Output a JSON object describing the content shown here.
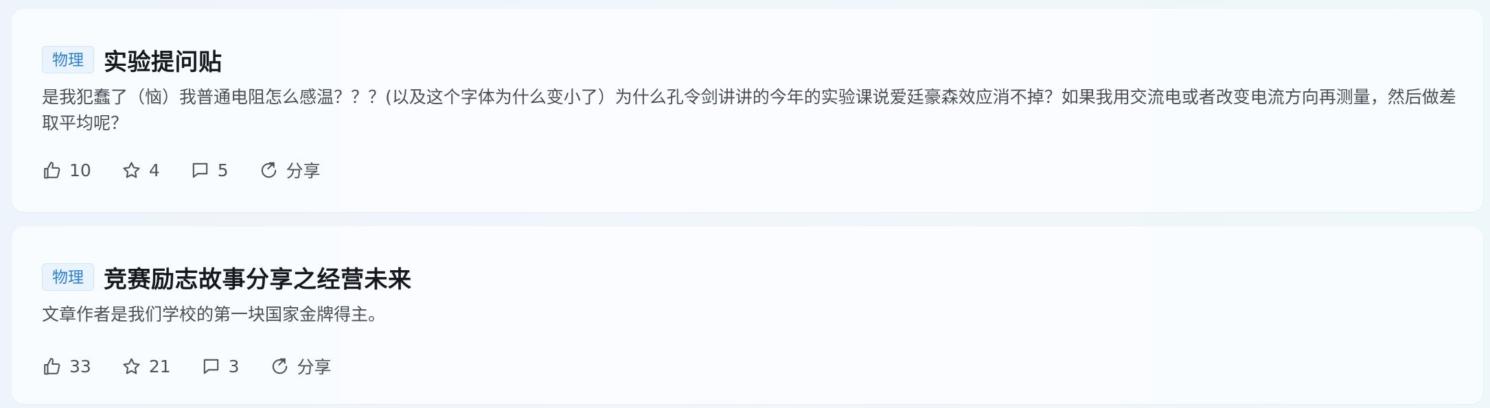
{
  "posts": [
    {
      "tag": "物理",
      "title": "实验提问贴",
      "excerpt": "是我犯蠢了（恼）我普通电阻怎么感温？？？(以及这个字体为什么变小了）为什么孔令剑讲讲的今年的实验课说爱廷豪森效应消不掉？如果我用交流电或者改变电流方向再测量，然后做差取平均呢？",
      "likes": "10",
      "favorites": "4",
      "comments": "5",
      "share_label": "分享"
    },
    {
      "tag": "物理",
      "title": "竞赛励志故事分享之经营未来",
      "excerpt": "文章作者是我们学校的第一块国家金牌得主。",
      "likes": "33",
      "favorites": "21",
      "comments": "3",
      "share_label": "分享"
    }
  ],
  "icons": {
    "like": "thumbs-up-icon",
    "favorite": "star-icon",
    "comment": "comment-bubble-icon",
    "share": "share-arrow-icon"
  },
  "colors": {
    "tag_text": "#2f7fd0",
    "tag_bg": "#e9f4fe",
    "title": "#15191f",
    "body_text": "#4a4f57"
  }
}
